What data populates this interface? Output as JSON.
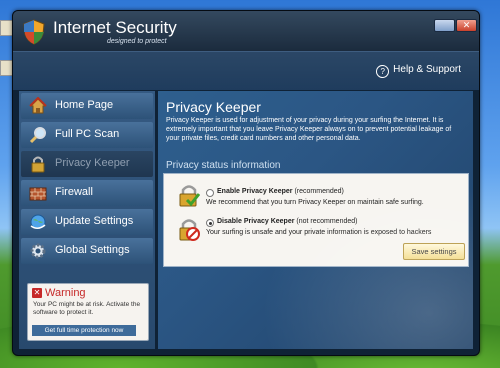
{
  "window": {
    "title": "Internet Security",
    "subtitle": "designed to protect"
  },
  "header": {
    "help_label": "Help & Support",
    "help_icon": "question-icon"
  },
  "sidebar": {
    "items": [
      {
        "label": "Home Page",
        "icon": "house-icon"
      },
      {
        "label": "Full PC Scan",
        "icon": "magnifier-icon"
      },
      {
        "label": "Privacy Keeper",
        "icon": "lock-icon"
      },
      {
        "label": "Firewall",
        "icon": "brick-wall-icon"
      },
      {
        "label": "Update Settings",
        "icon": "globe-update-icon"
      },
      {
        "label": "Global Settings",
        "icon": "gear-icon"
      }
    ],
    "warning": {
      "title": "Warning",
      "text": "Your PC might be at risk. Activate the software to protect it.",
      "link": "Get full time protection now"
    }
  },
  "main": {
    "title": "Privacy Keeper",
    "description": "Privacy Keeper is used for adjustment of your privacy during your surfing the Internet. It is extremely important that you leave Privacy Keeper always on to prevent potential leakage of your private files, credit card numbers and other personal data.",
    "section_title": "Privacy status information",
    "options": [
      {
        "title": "Enable Privacy Keeper",
        "tag": "(recommended)",
        "text": "We recommend that you turn Privacy Keeper on maintain safe surfing.",
        "selected": false
      },
      {
        "title": "Disable Privacy Keeper",
        "tag": "(not recommended)",
        "text": "Your surfing is unsafe and your private information is exposed to hackers",
        "selected": true
      }
    ],
    "save_label": "Save settings"
  },
  "colors": {
    "accent": "#2b5684",
    "warning": "#c62828",
    "button": "#f3dc8c"
  }
}
